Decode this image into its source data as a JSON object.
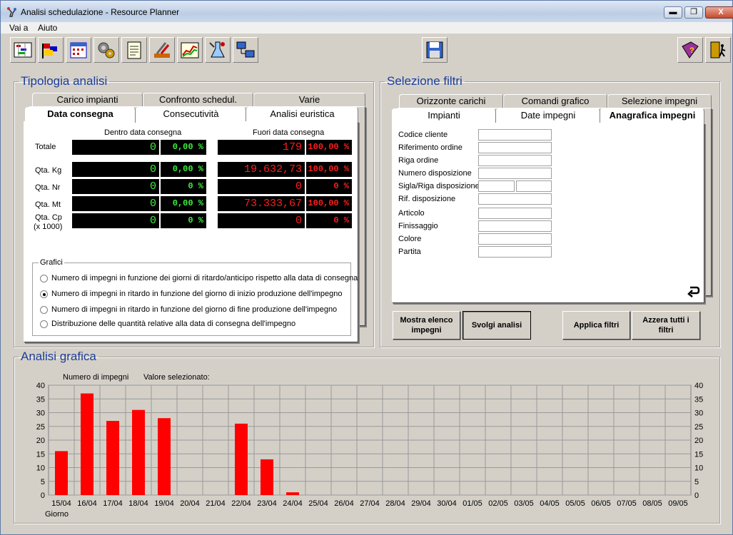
{
  "window": {
    "title": "Analisi schedulazione - Resource Planner",
    "min_label": "▬",
    "max_label": "❐",
    "close_label": "X"
  },
  "menu": [
    "Vai a",
    "Aiuto"
  ],
  "toolbar": {
    "buttons": [
      {
        "icon": "schedule-grid-icon"
      },
      {
        "icon": "flags-icon"
      },
      {
        "icon": "calendar-icon"
      },
      {
        "icon": "gears-icon"
      },
      {
        "icon": "notepad-icon"
      },
      {
        "icon": "tools-icon"
      },
      {
        "icon": "line-chart-icon"
      },
      {
        "icon": "lab-icon"
      },
      {
        "icon": "network-icon"
      },
      {
        "icon": "save-icon"
      },
      {
        "icon": "help-book-icon"
      },
      {
        "icon": "exit-door-icon"
      }
    ]
  },
  "tipologia": {
    "legend": "Tipologia analisi",
    "tabs_row1": [
      "Carico impianti",
      "Confronto schedul.",
      "Varie"
    ],
    "tabs_row2": [
      "Data consegna",
      "Consecutività",
      "Analisi euristica"
    ],
    "col_inside": "Dentro data consegna",
    "col_outside": "Fuori data consegna",
    "rows": [
      {
        "label": "Totale",
        "label2": "",
        "in_val": "0",
        "in_pct": "0,00 %",
        "out_val": "179",
        "out_pct": "100,00 %"
      },
      {
        "label": "Qta. Kg",
        "label2": "",
        "in_val": "0",
        "in_pct": "0,00 %",
        "out_val": "19.632,73",
        "out_pct": "100,00 %"
      },
      {
        "label": "Qta. Nr",
        "label2": "",
        "in_val": "0",
        "in_pct": "0 %",
        "out_val": "0",
        "out_pct": "0 %"
      },
      {
        "label": "Qta. Mt",
        "label2": "",
        "in_val": "0",
        "in_pct": "0,00 %",
        "out_val": "73.333,67",
        "out_pct": "100,00 %"
      },
      {
        "label": "Qta. Cp",
        "label2": "(x 1000)",
        "in_val": "0",
        "in_pct": "0 %",
        "out_val": "0",
        "out_pct": "0 %"
      }
    ],
    "grafici": {
      "title": "Grafici",
      "options": [
        {
          "label": "Numero di impegni in funzione dei giorni di ritardo/anticipo rispetto alla data di consegna",
          "checked": false
        },
        {
          "label": "Numero di impegni in ritardo in funzione del giorno di inizio produzione dell'impegno",
          "checked": true
        },
        {
          "label": "Numero di impegni in ritardo in funzione del giorno di fine produzione dell'impegno",
          "checked": false
        },
        {
          "label": "Distribuzione delle quantità relative alla data di consegna dell'impegno",
          "checked": false
        }
      ]
    }
  },
  "filtri": {
    "legend": "Selezione filtri",
    "tabs_row1": [
      "Orizzonte carichi",
      "Comandi grafico",
      "Selezione impegni"
    ],
    "tabs_row2": [
      "Impianti",
      "Date impegni",
      "Anagrafica impegni"
    ],
    "fields": [
      {
        "label": "Codice cliente",
        "value": "",
        "split": false
      },
      {
        "label": "Riferimento ordine",
        "value": "",
        "split": false
      },
      {
        "label": "Riga ordine",
        "value": "",
        "split": false
      },
      {
        "label": "Numero disposizione",
        "value": "",
        "split": false
      },
      {
        "label": "Sigla/Riga disposizione",
        "value": "",
        "split": true
      },
      {
        "label": "Rif. disposizione",
        "value": "",
        "split": false
      },
      {
        "label": "Articolo",
        "value": "",
        "split": false
      },
      {
        "label": "Finissaggio",
        "value": "",
        "split": false
      },
      {
        "label": "Colore",
        "value": "",
        "split": false
      },
      {
        "label": "Partita",
        "value": "",
        "split": false
      }
    ],
    "buttons": {
      "mostra": "Mostra elenco impegni",
      "svolgi": "Svolgi analisi",
      "applica": "Applica filtri",
      "azzera": "Azzera tutti i filtri"
    }
  },
  "analisi_grafica": {
    "legend": "Analisi grafica",
    "ylabel": "Numero di impegni",
    "selected_label": "Valore selezionato:",
    "xlabel": "Giorno"
  },
  "chart_data": {
    "type": "bar",
    "categories": [
      "15/04",
      "16/04",
      "17/04",
      "18/04",
      "19/04",
      "20/04",
      "21/04",
      "22/04",
      "23/04",
      "24/04",
      "25/04",
      "26/04",
      "27/04",
      "28/04",
      "29/04",
      "30/04",
      "01/05",
      "02/05",
      "03/05",
      "04/05",
      "05/05",
      "06/05",
      "07/05",
      "08/05",
      "09/05"
    ],
    "values": [
      16,
      37,
      27,
      31,
      28,
      0,
      0,
      26,
      13,
      1,
      0,
      0,
      0,
      0,
      0,
      0,
      0,
      0,
      0,
      0,
      0,
      0,
      0,
      0,
      0
    ],
    "ylim": [
      0,
      40
    ],
    "yticks": [
      0,
      5,
      10,
      15,
      20,
      25,
      30,
      35,
      40
    ],
    "ylabel": "Numero di impegni",
    "xlabel": "Giorno",
    "bar_color": "#ff0000",
    "grid": true
  }
}
